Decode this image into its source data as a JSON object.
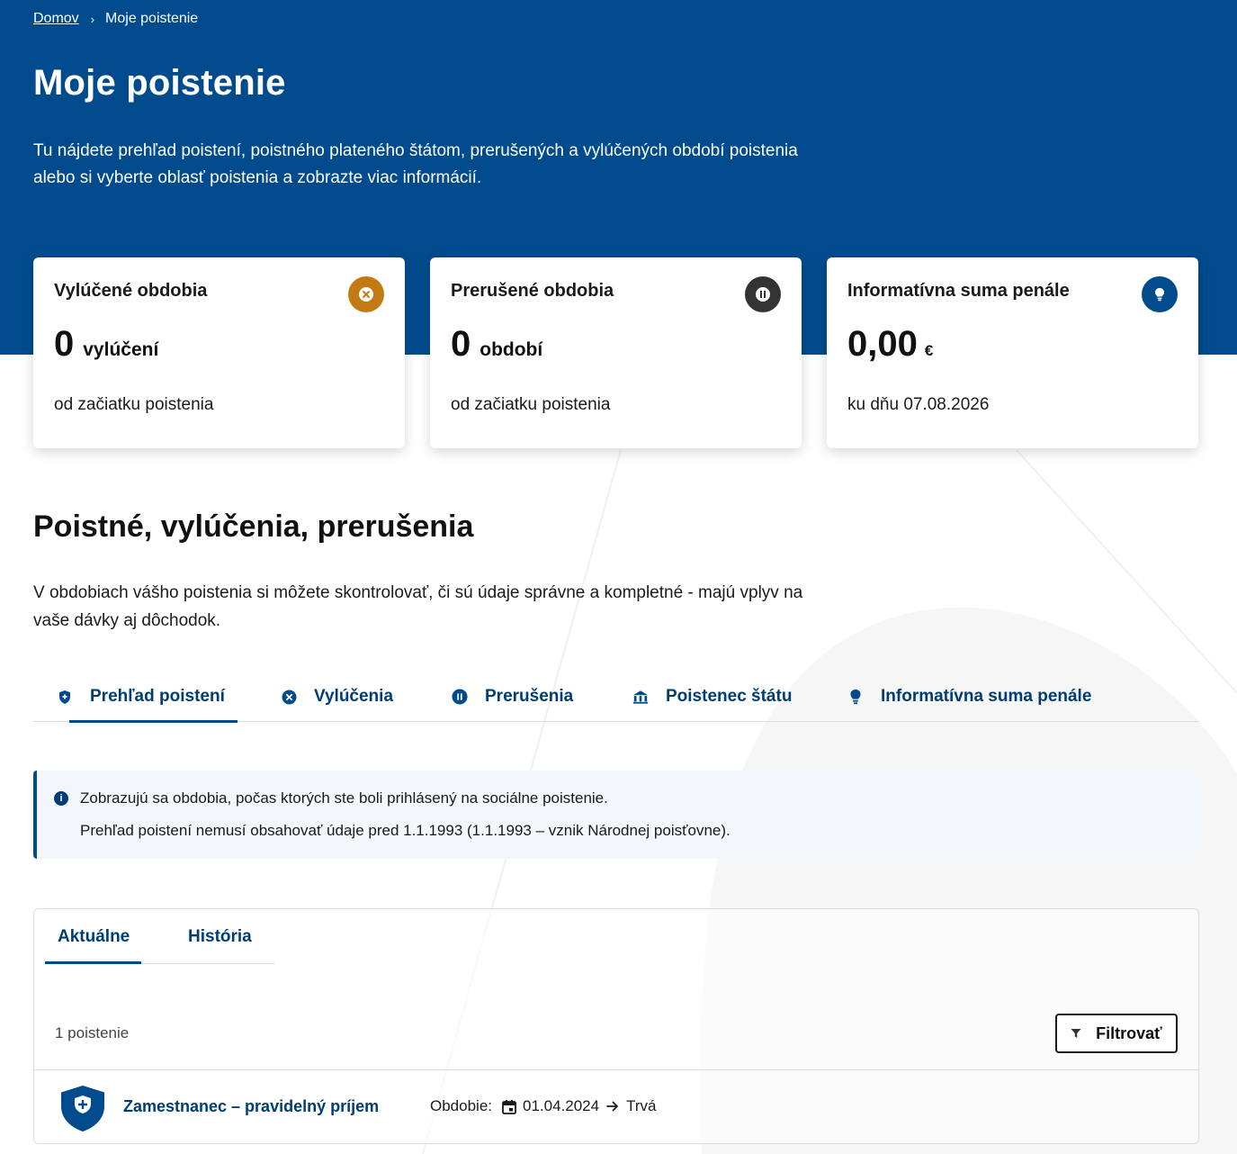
{
  "breadcrumb": {
    "home": "Domov",
    "separator": "›",
    "current": "Moje poistenie"
  },
  "header": {
    "title": "Moje poistenie",
    "intro": "Tu nájdete prehľad poistení, poistného plateného štátom, prerušených a vylúčených období poistenia alebo si vyberte oblasť poistenia a zobrazte viac informácií."
  },
  "cards": [
    {
      "title": "Vylúčené obdobia",
      "value": "0",
      "unit": "vylúčení",
      "sub": "od začiatku poistenia",
      "icon": "close-circle-icon",
      "icon_color": "#c47a12"
    },
    {
      "title": "Prerušené obdobia",
      "value": "0",
      "unit": "období",
      "sub": "od začiatku poistenia",
      "icon": "pause-icon",
      "icon_color": "#333333"
    },
    {
      "title": "Informatívna suma penále",
      "value": "0,00",
      "unit": "€",
      "sub": "ku dňu 07.08.2026",
      "icon": "lightbulb-icon",
      "icon_color": "#004b8d"
    }
  ],
  "section": {
    "title": "Poistné, vylúčenia, prerušenia",
    "intro": "V obdobiach vášho poistenia si môžete skontrolovať, či sú údaje správne a kompletné - majú vplyv na vaše dávky aj dôchodok."
  },
  "tabs": [
    {
      "label": "Prehľad poistení",
      "icon": "shield-plus-icon",
      "active": true
    },
    {
      "label": "Vylúčenia",
      "icon": "close-circle-icon"
    },
    {
      "label": "Prerušenia",
      "icon": "pause-icon"
    },
    {
      "label": "Poistenec štátu",
      "icon": "state-building-icon"
    },
    {
      "label": "Informatívna suma penále",
      "icon": "lightbulb-icon"
    }
  ],
  "info": {
    "icon": "info-icon",
    "line1": "Zobrazujú sa obdobia, počas ktorých ste boli prihlásený na sociálne poistenie.",
    "line2": "Prehľad poistení nemusí obsahovať údaje pred 1.1.1993 (1.1.1993 – vznik Národnej poisťovne)."
  },
  "panel": {
    "subtabs": [
      {
        "label": "Aktuálne",
        "active": true
      },
      {
        "label": "História"
      }
    ],
    "count": "1 poistenie",
    "filter_label": "Filtrovať",
    "rows": [
      {
        "title": "Zamestnanec – pravidelný príjem",
        "period_label": "Obdobie:",
        "from": "01.04.2024",
        "to": "Trvá"
      }
    ]
  },
  "colors": {
    "primary": "#004b8d",
    "link": "#003d75",
    "warning": "#c47a12"
  }
}
